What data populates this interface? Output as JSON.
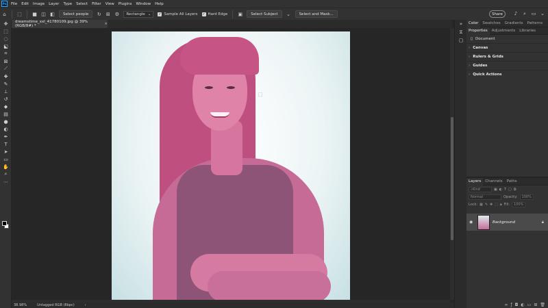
{
  "app": {
    "logo": "Ps"
  },
  "menu": [
    "File",
    "Edit",
    "Image",
    "Layer",
    "Type",
    "Select",
    "Filter",
    "View",
    "Plugins",
    "Window",
    "Help"
  ],
  "options": {
    "select_people": "Select people",
    "mode": "Rectangle",
    "sample_all_layers": "Sample All Layers",
    "hard_edge": "Hard Edge",
    "select_subject": "Select Subject",
    "select_and_mask": "Select and Mask...",
    "share": "Share"
  },
  "document": {
    "tab_title": "dreamstime_xxl_41780109.jpg @ 39% (RGB/8#) *",
    "close": "×"
  },
  "status": {
    "zoom": "38.98%",
    "profile": "Untagged RGB (8bpc)"
  },
  "panels": {
    "top_tabs": [
      "Color",
      "Swatches",
      "Gradients",
      "Patterns"
    ],
    "props_tabs": [
      "Properties",
      "Adjustments",
      "Libraries"
    ],
    "document_label": "Document",
    "sections": [
      "Canvas",
      "Rulers & Grids",
      "Guides",
      "Quick Actions"
    ]
  },
  "layers_panel": {
    "tabs": [
      "Layers",
      "Channels",
      "Paths"
    ],
    "kind_placeholder": "Kind",
    "blend_mode": "Normal",
    "opacity_label": "Opacity:",
    "opacity_value": "100%",
    "lock_label": "Lock:",
    "fill_label": "Fill:",
    "fill_value": "100%",
    "layer_name": "Background"
  },
  "colors": {
    "accent": "#31a8ff",
    "selected_layer": "#4a4a4a",
    "overlay": "#c0457a"
  },
  "icons": {
    "toolbar": [
      "move-icon",
      "artboard-icon",
      "lasso-icon",
      "object-select-icon",
      "crop-icon",
      "frame-icon",
      "eyedropper-icon",
      "healing-icon",
      "brush-icon",
      "stamp-icon",
      "history-brush-icon",
      "eraser-icon",
      "gradient-icon",
      "blur-icon",
      "dodge-icon",
      "pen-icon",
      "type-icon",
      "path-select-icon",
      "rectangle-icon",
      "hand-icon",
      "zoom-icon",
      "more-icon"
    ]
  }
}
